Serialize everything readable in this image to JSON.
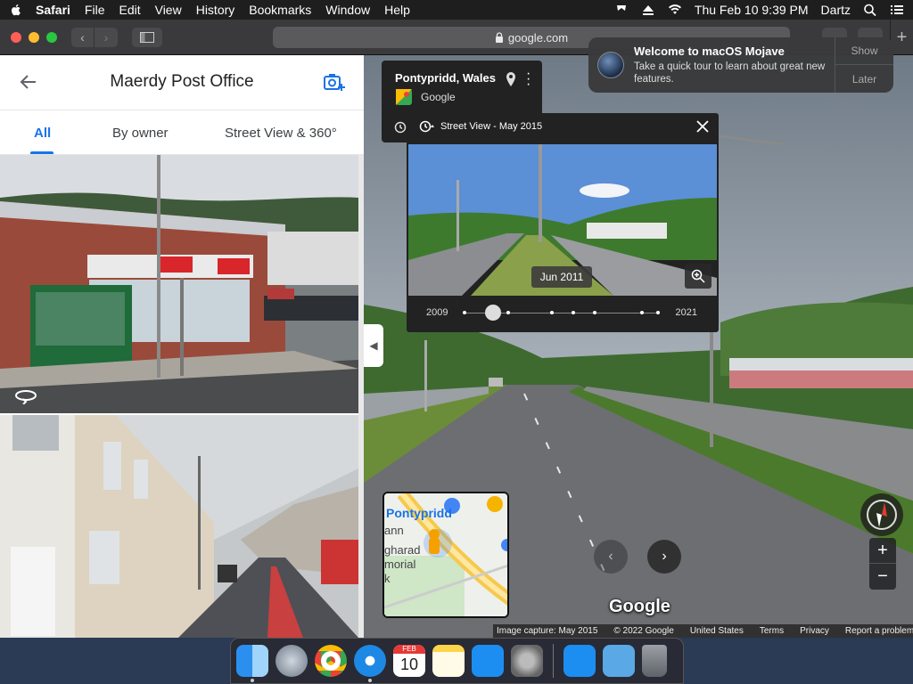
{
  "menubar": {
    "app": "Safari",
    "items": [
      "File",
      "Edit",
      "View",
      "History",
      "Bookmarks",
      "Window",
      "Help"
    ],
    "clock": "Thu Feb 10  9:39 PM",
    "user": "Dartz"
  },
  "toolbar": {
    "url": "google.com"
  },
  "place": {
    "title": "Maerdy Post Office",
    "tabs": [
      "All",
      "By owner",
      "Street View & 360°"
    ]
  },
  "location_card": {
    "name": "Pontypridd, Wales",
    "brand": "Google"
  },
  "streetview": {
    "header": "Street View - May 2015",
    "hover_date": "Jun 2011",
    "timeline_start": "2009",
    "timeline_end": "2021"
  },
  "notification": {
    "title": "Welcome to macOS Mojave",
    "body": "Take a quick tour to learn about great new features.",
    "show": "Show",
    "later": "Later"
  },
  "minimap": {
    "label1": "Pontypridd",
    "label2": "ann",
    "label3": "gharad",
    "label4": "morial",
    "label5": "k"
  },
  "map": {
    "logo": "Google",
    "attribution": [
      "Image capture: May 2015",
      "© 2022 Google",
      "United States",
      "Terms",
      "Privacy",
      "Report a problem"
    ]
  },
  "dock": {
    "calendar_month": "FEB",
    "calendar_day": "10"
  },
  "colors": {
    "accent": "#1a73e8",
    "menubar": "#1e1e1e",
    "close": "#ff5f57",
    "minimize": "#febc2e",
    "zoom": "#28c840"
  }
}
